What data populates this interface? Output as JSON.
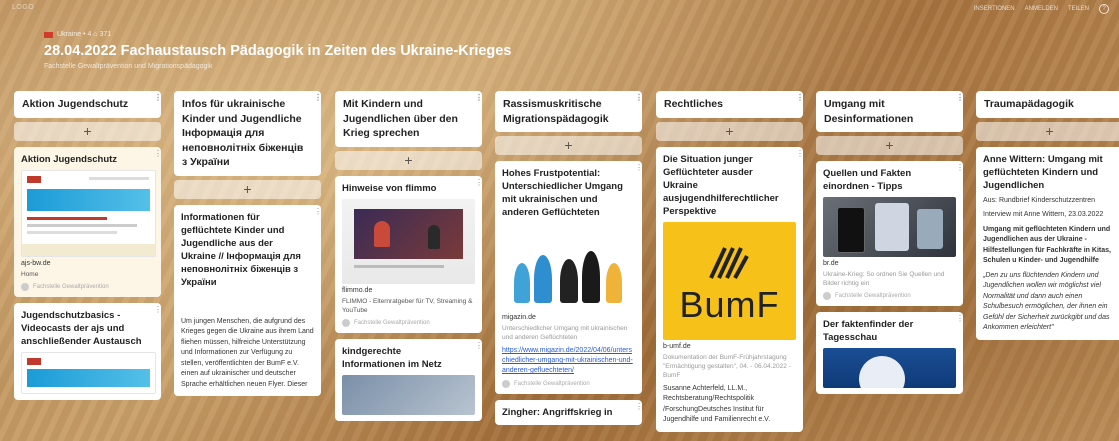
{
  "app": {
    "brand": "LOGO"
  },
  "topnav": {
    "item1": "INSERTIONEN",
    "item2": "ANMELDEN",
    "item3": "TEILEN"
  },
  "breadcrumb": {
    "text": "Ukraine • 4 ⌂ 371"
  },
  "board": {
    "title": "28.04.2022 Fachaustausch Pädagogik in Zeiten des Ukraine-Krieges",
    "subtitle": "Fachstelle Gewaltprävention und Migrationspädagogik"
  },
  "columns": [
    {
      "title": "Aktion Jugendschutz",
      "cards": [
        {
          "title": "Aktion Jugendschutz",
          "domain": "ajs-bw.de",
          "label": "Home",
          "meta": "Fachstelle Gewaltprävention"
        },
        {
          "title": "Jugendschutzbasics - Videocasts der ajs und anschließender Austausch"
        }
      ]
    },
    {
      "title": "Infos für ukrainische Kinder und Jugendliche Інформація для неповнолітніх біженців з України",
      "cards": [
        {
          "title": "Informationen für geflüchtete Kinder und Jugendliche aus der Ukraine // Інформація для неповнолітніх біженців з України",
          "text": "Um jungen Menschen, die aufgrund des Krieges gegen die Ukraine aus ihrem Land fliehen müssen, hilfreiche Unterstützung und Informationen zur Verfügung zu stellen, veröffentlichten der BumF e.V. einen auf ukrainischer und deutscher Sprache erhältlichen neuen Flyer. Dieser"
        }
      ]
    },
    {
      "title": "Mit Kindern und Jugendlichen über den Krieg sprechen",
      "cards": [
        {
          "title": "Hinweise von flimmo",
          "domain": "flimmo.de",
          "text": "FLIMMO - Elternratgeber für TV, Streaming & YouTube",
          "meta": "Fachstelle Gewaltprävention"
        },
        {
          "title": "kindgerechte Informationen im Netz"
        }
      ]
    },
    {
      "title": "Rassismuskritische Migrationspädagogik",
      "cards": [
        {
          "title": "Hohes Frustpotential: Unterschiedlicher Umgang mit ukrainischen und anderen Geflüchteten",
          "domain": "migazin.de",
          "text": "Unterschiedlicher Umgang mit ukrainischen und anderen Geflüchteten",
          "link": "https://www.migazin.de/2022/04/06/unterschiedlicher-umgang-mit-ukrainischen-und-anderen-gefluechteten/",
          "meta": "Fachstelle Gewaltprävention"
        },
        {
          "title": "Zingher: Angriffskrieg in"
        }
      ]
    },
    {
      "title": "Rechtliches",
      "cards": [
        {
          "title": "Die Situation junger Geflüchteter ausder Ukraine ausjugendhilferechtlicher Perspektive",
          "logo_text": "BumF",
          "domain": "b-umf.de",
          "text": "Dokumentation der BumF-Frühjahrstagung \"Ermächtigung gestalten\", 04. - 06.04.2022 - BumF",
          "body": "Susanne Achterfeld, LL.M., Rechtsberatung/Rechtspolitik /ForschungDeutsches Institut für Jugendhilfe und Familienrecht e.V."
        }
      ]
    },
    {
      "title": "Umgang mit Desinformationen",
      "cards": [
        {
          "title": "Quellen und Fakten einordnen - Tipps",
          "domain": "br.de",
          "text": "Ukraine-Krieg: So ordnen Sie Quellen und Bilder richtig ein",
          "meta": "Fachstelle Gewaltprävention"
        },
        {
          "title": "Der faktenfinder der Tagesschau"
        }
      ]
    },
    {
      "title": "Traumapädagogik",
      "cards": [
        {
          "title": "Anne Wittern: Umgang mit geflüchteten Kindern und Jugendlichen",
          "text1": "Aus: Rundbrief Kinderschutzzentren",
          "text2": "Interview mit Anne Wittern, 23.03.2022",
          "bold": "Umgang mit geflüchteten Kindern und Jugendlichen aus der Ukraine - Hilfestellungen für Fachkräfte in Kitas, Schulen u Kinder- und Jugendhilfe",
          "quote": "„Den zu uns flüchtenden Kindern und Jugendlichen wollen wir möglichst viel Normalität und dann auch einen Schulbesuch ermöglichen, der ihnen ein Gefühl der Sicherheit zurückgibt und das Ankommen erleichtert\""
        }
      ]
    }
  ],
  "ui": {
    "add_symbol": "+",
    "kebab_symbol": "⋮"
  },
  "colors": {
    "accent_red": "#c0392b",
    "link_blue": "#2a5bd7",
    "bumf_yellow": "#f6c21a"
  }
}
